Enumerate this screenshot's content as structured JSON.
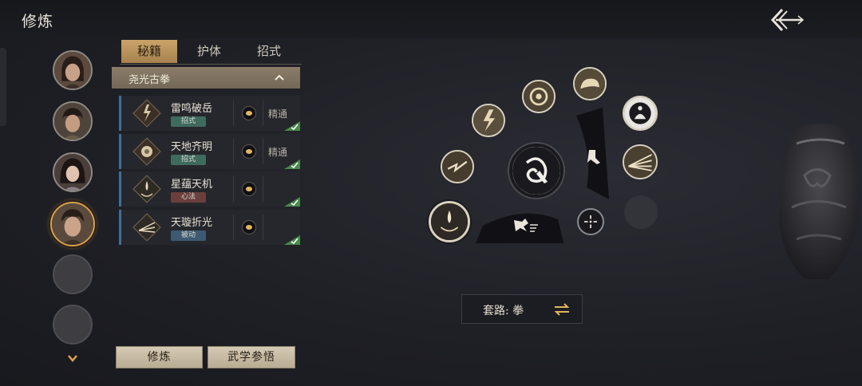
{
  "header": {
    "title": "修炼",
    "back_icon": "back-arrow-icon"
  },
  "characters": [
    {
      "name": "character-1",
      "state": "filled"
    },
    {
      "name": "character-2",
      "state": "filled"
    },
    {
      "name": "character-3",
      "state": "filled"
    },
    {
      "name": "character-4",
      "state": "selected"
    },
    {
      "name": "slot-5",
      "state": "empty"
    },
    {
      "name": "slot-6",
      "state": "empty"
    }
  ],
  "tabs": [
    {
      "label": "秘籍",
      "active": true
    },
    {
      "label": "护体",
      "active": false
    },
    {
      "label": "招式",
      "active": false
    }
  ],
  "group": {
    "label": "尧光古拳",
    "expanded": true
  },
  "skills": [
    {
      "name": "雷鸣破岳",
      "tag": "招式",
      "tag_color": "green",
      "mastery": "精通",
      "checked": true
    },
    {
      "name": "天地齐明",
      "tag": "招式",
      "tag_color": "green",
      "mastery": "精通",
      "checked": true
    },
    {
      "name": "星蕴天机",
      "tag": "心法",
      "tag_color": "red",
      "mastery": "",
      "checked": true
    },
    {
      "name": "天璇折光",
      "tag": "被动",
      "tag_color": "blue",
      "mastery": "",
      "checked": true
    }
  ],
  "buttons": {
    "train": "修炼",
    "insight": "武学参悟"
  },
  "route": {
    "label": "套路: 拳"
  },
  "colors": {
    "accent_gold": "#d9a14a",
    "tab_active": "#c9a36a",
    "row_border": "#3f6f9c",
    "check_green": "#4a8a4e"
  }
}
